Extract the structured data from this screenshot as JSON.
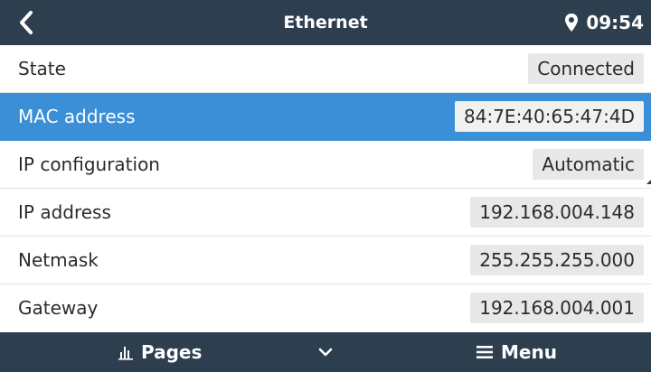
{
  "header": {
    "title": "Ethernet",
    "time": "09:54",
    "back_icon": "chevron-left-icon",
    "location_icon": "map-pin-icon"
  },
  "rows": [
    {
      "label": "State",
      "value": "Connected"
    },
    {
      "label": "MAC address",
      "value": "84:7E:40:65:47:4D",
      "selected": true
    },
    {
      "label": "IP configuration",
      "value": "Automatic"
    },
    {
      "label": "IP address",
      "value": "192.168.004.148"
    },
    {
      "label": "Netmask",
      "value": "255.255.255.000"
    },
    {
      "label": "Gateway",
      "value": "192.168.004.001"
    }
  ],
  "footer": {
    "pages_label": "Pages",
    "menu_label": "Menu",
    "pages_icon": "bar-chart-icon",
    "menu_icon": "hamburger-icon",
    "scroll_icon": "chevron-down-icon"
  },
  "colors": {
    "bar_bg": "#2d3e4f",
    "selected_row": "#3b8fd6",
    "value_bg": "#e8e8e8"
  }
}
